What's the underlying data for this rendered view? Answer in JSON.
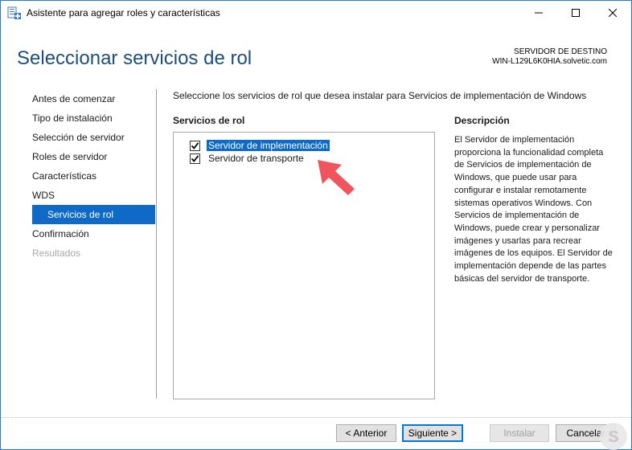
{
  "window": {
    "title": "Asistente para agregar roles y características"
  },
  "header": {
    "page_title": "Seleccionar servicios de rol",
    "destination_label": "SERVIDOR DE DESTINO",
    "destination_server": "WIN-L129L6K0HIA.solvetic.com"
  },
  "nav": {
    "items": [
      {
        "label": "Antes de comenzar",
        "state": "normal"
      },
      {
        "label": "Tipo de instalación",
        "state": "normal"
      },
      {
        "label": "Selección de servidor",
        "state": "normal"
      },
      {
        "label": "Roles de servidor",
        "state": "normal"
      },
      {
        "label": "Características",
        "state": "normal"
      },
      {
        "label": "WDS",
        "state": "normal"
      },
      {
        "label": "Servicios de rol",
        "state": "active"
      },
      {
        "label": "Confirmación",
        "state": "normal"
      },
      {
        "label": "Resultados",
        "state": "disabled"
      }
    ]
  },
  "main": {
    "instruction": "Seleccione los servicios de rol que desea instalar para Servicios de implementación de Windows",
    "services_header": "Servicios de rol",
    "description_header": "Descripción",
    "services": [
      {
        "label": "Servidor de implementación",
        "checked": true,
        "selected": true
      },
      {
        "label": "Servidor de transporte",
        "checked": true,
        "selected": false
      }
    ],
    "description": "El Servidor de implementación proporciona la funcionalidad completa de Servicios de implementación de Windows, que puede usar para configurar e instalar remotamente sistemas operativos Windows. Con Servicios de implementación de Windows, puede crear y personalizar imágenes y usarlas para recrear imágenes de los equipos. El Servidor de implementación depende de las partes básicas del servidor de transporte."
  },
  "footer": {
    "prev_label": "< Anterior",
    "next_label": "Siguiente >",
    "install_label": "Instalar",
    "cancel_label": "Cancelar"
  },
  "colors": {
    "accent": "#0e6ac6",
    "title_blue": "#1e4e79",
    "annotation_arrow": "#f0545c"
  }
}
